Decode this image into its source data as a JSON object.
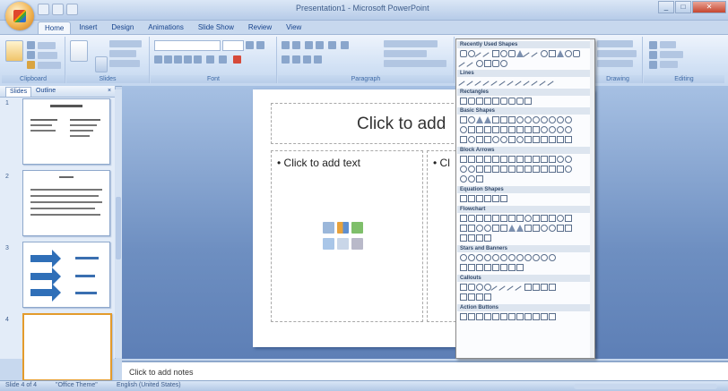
{
  "window": {
    "title": "Presentation1 - Microsoft PowerPoint",
    "controls": [
      "_",
      "□",
      "✕"
    ]
  },
  "ribbon": {
    "tabs": [
      "Home",
      "Insert",
      "Design",
      "Animations",
      "Slide Show",
      "Review",
      "View"
    ],
    "active_tab": "Home",
    "groups": [
      "Clipboard",
      "Slides",
      "Font",
      "Paragraph",
      "Drawing",
      "Editing"
    ]
  },
  "left_pane": {
    "tabs": [
      "Slides",
      "Outline"
    ],
    "close": "×",
    "slide_numbers": [
      "1",
      "2",
      "3",
      "4"
    ]
  },
  "slide": {
    "title_placeholder": "Click to add",
    "left_body_placeholder": "• Click to add text",
    "right_body_placeholder": "• Cl"
  },
  "notes": {
    "placeholder": "Click to add notes"
  },
  "statusbar": {
    "slide_info": "Slide 4 of 4",
    "theme": "\"Office Theme\"",
    "language": "English (United States)"
  },
  "shapes_menu": {
    "sections": [
      "Recently Used Shapes",
      "Lines",
      "Rectangles",
      "Basic Shapes",
      "Block Arrows",
      "Equation Shapes",
      "Flowchart",
      "Stars and Banners",
      "Callouts",
      "Action Buttons"
    ]
  },
  "colors": {
    "accent": "#e39b2c",
    "ribbon": "#d3e2f5",
    "workspace": "#6e8fc1"
  }
}
